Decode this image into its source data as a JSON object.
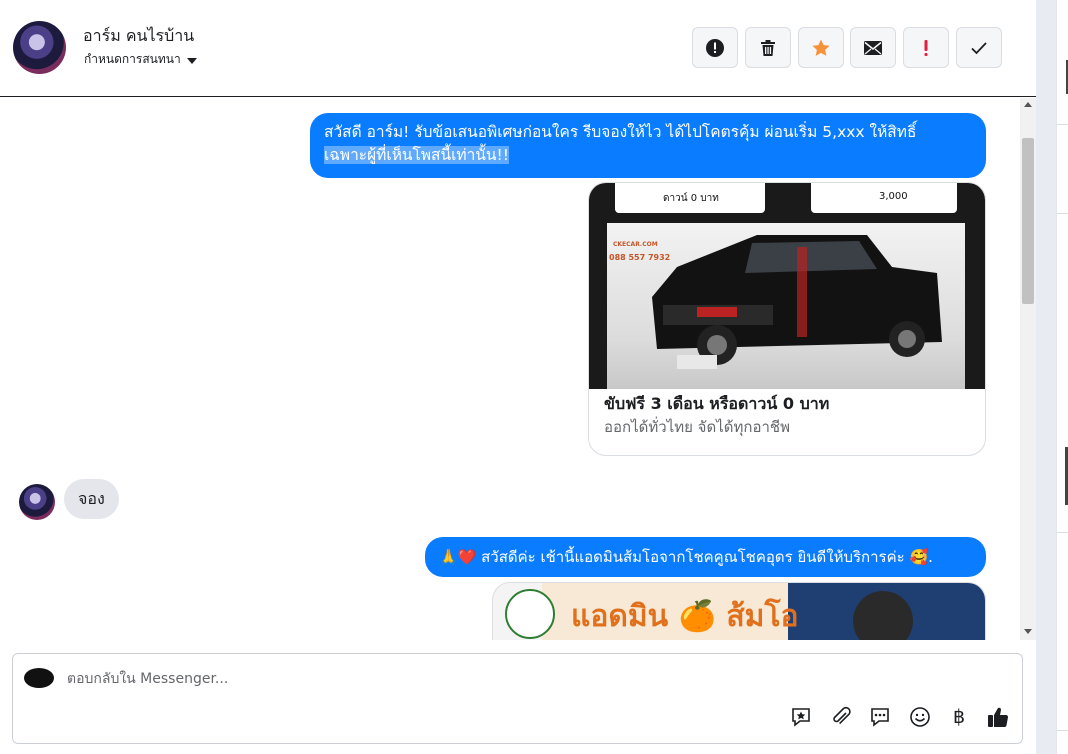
{
  "header": {
    "contact_name": "อาร์ม คนไรบ้าน",
    "conversation_settings": "กำหนดการสนทนา",
    "actions": [
      {
        "name": "report-spam",
        "icon": "alert-circle-icon"
      },
      {
        "name": "delete",
        "icon": "trash-icon"
      },
      {
        "name": "star",
        "icon": "star-icon"
      },
      {
        "name": "mark-unread",
        "icon": "envelope-icon"
      },
      {
        "name": "mark-important",
        "icon": "exclamation-icon"
      },
      {
        "name": "mark-done",
        "icon": "check-icon"
      }
    ]
  },
  "messages": {
    "m1_line1": "สวัสดี อาร์ม! รับข้อเสนอพิเศษก่อนใคร รีบจองให้ไว ได้ไปโคตรคุ้ม ผ่อนเริ่ม 5,xxx  ให้สิทธิ์",
    "m1_line2": "เฉพาะผู้ที่เห็นโพสนี้เท่านั้น!!",
    "card": {
      "title": "ขับฟรี 3 เดือน หรือดาวน์ 0 บาท",
      "subtitle": "ออกได้ทั่วไทย จัดได้ทุกอาชีพ",
      "image_strip_left": "ดาวน์ 0 บาท",
      "image_strip_right": "3,000",
      "image_logo": "CKECAR.COM",
      "image_phone": "088 557 7932"
    },
    "m2_reply": "จอง",
    "m3_text": "🙏❤️ สวัสดีค่ะ เช้านี้แอดมินส้มโอจากโชคคูณโชคอุดร ยินดีให้บริการค่ะ  🥰.",
    "banner_text": "แอดมิน 🍊 ส้มโอ"
  },
  "composer": {
    "placeholder": "ตอบกลับใน Messenger...",
    "value": "",
    "tools": [
      {
        "name": "saved-reply",
        "icon": "star-bubble-icon"
      },
      {
        "name": "attach",
        "icon": "paperclip-icon"
      },
      {
        "name": "quick-replies",
        "icon": "chat-dots-icon"
      },
      {
        "name": "emoji",
        "icon": "smiley-icon"
      },
      {
        "name": "payment",
        "icon": "baht-icon",
        "glyph": "฿"
      },
      {
        "name": "like",
        "icon": "thumbs-up-icon"
      }
    ]
  },
  "colors": {
    "outgoing_bubble": "#0a7cff",
    "incoming_bubble": "#e4e6eb",
    "star_accent": "#f7923a",
    "important_red": "#e41e3f"
  }
}
